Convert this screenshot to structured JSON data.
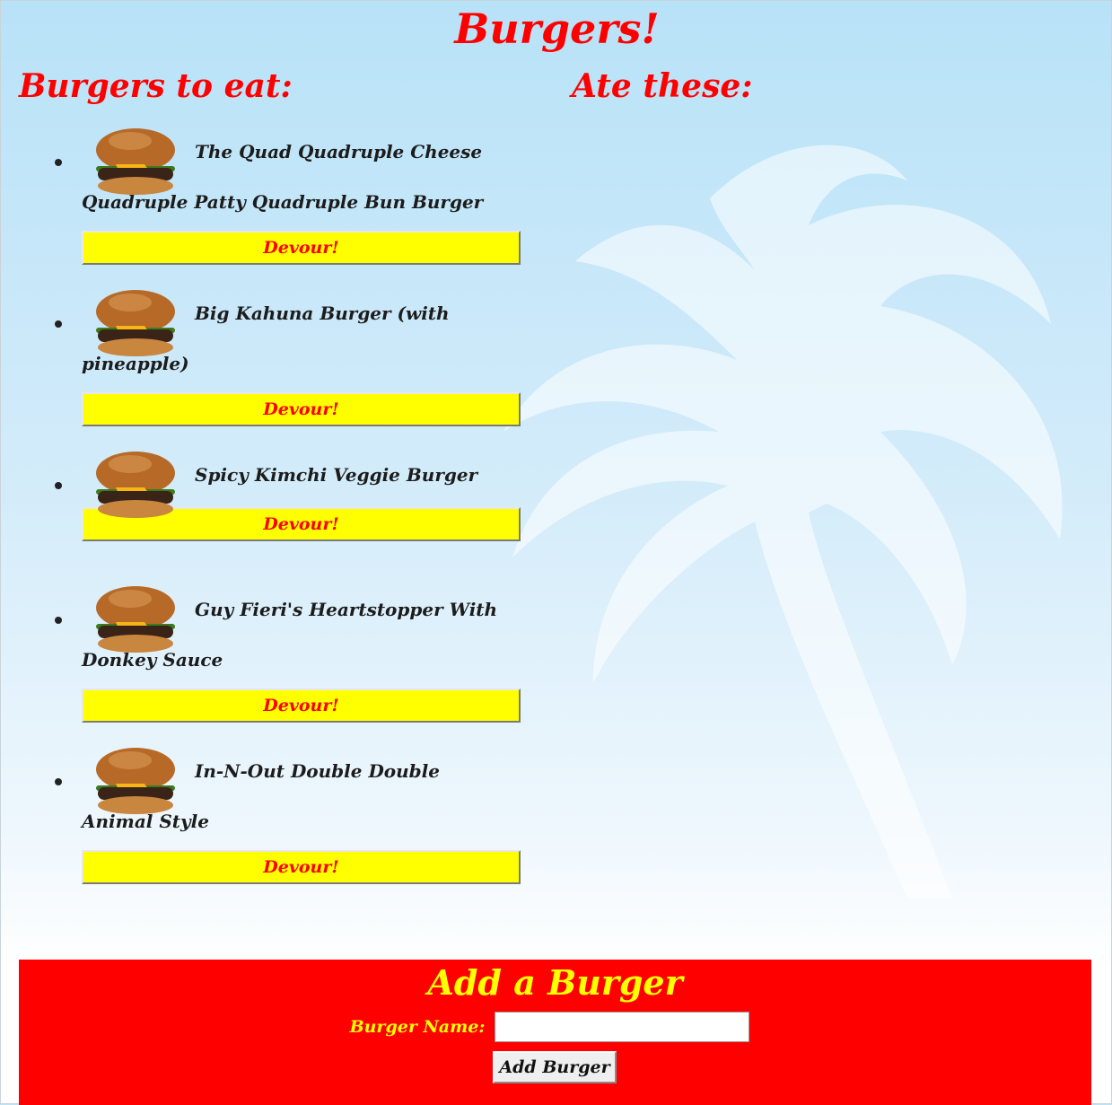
{
  "page_title": "Burgers!",
  "columns": {
    "to_eat_heading": "Burgers to eat:",
    "eaten_heading": "Ate these:"
  },
  "burgers_to_eat": [
    {
      "name": "The Quad Quadruple Cheese Quadruple Patty Quadruple Bun Burger",
      "button_label": "Devour!"
    },
    {
      "name": "Big Kahuna Burger (with pineapple)",
      "button_label": "Devour!"
    },
    {
      "name": "Spicy Kimchi Veggie Burger",
      "button_label": "Devour!"
    },
    {
      "name": "Guy Fieri's Heartstopper With Donkey Sauce",
      "button_label": "Devour!"
    },
    {
      "name": "In-N-Out Double Double Animal Style",
      "button_label": "Devour!"
    }
  ],
  "burgers_eaten": [],
  "add_form": {
    "title": "Add a Burger",
    "label": "Burger Name:",
    "input_value": "",
    "submit_label": "Add Burger"
  },
  "colors": {
    "heading": "#ff0000",
    "button_bg": "#ffff00",
    "panel_bg": "#ff0000",
    "panel_text": "#ffff00"
  },
  "icons": {
    "burger_image": "cheeseburger-image",
    "background": "palm-tree-watermark"
  }
}
